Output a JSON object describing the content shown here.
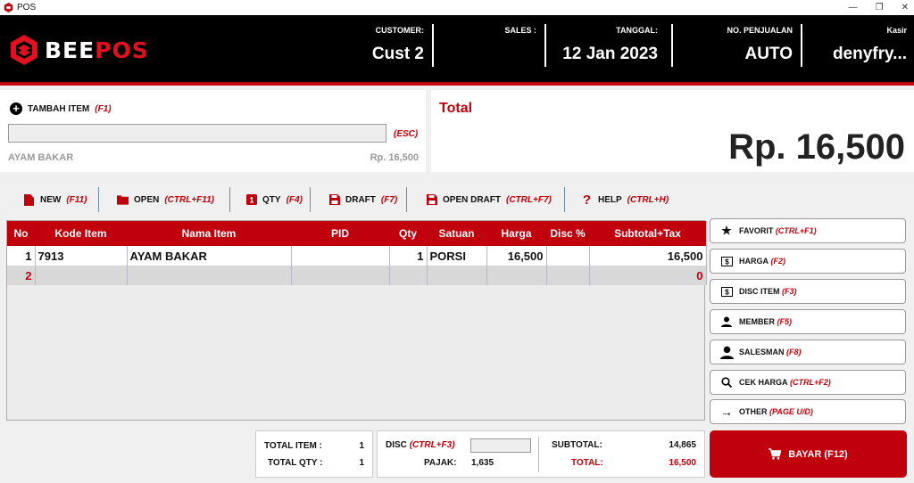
{
  "window": {
    "title": "POS",
    "controls": [
      "—",
      "❐",
      "✕"
    ]
  },
  "logo": {
    "part1": "BEE",
    "part2": "POS"
  },
  "header": {
    "customer_label": "CUSTOMER:",
    "customer_value": "Cust 2",
    "sales_label": "SALES :",
    "sales_value": "",
    "tanggal_label": "TANGGAL:",
    "tanggal_value": "12 Jan 2023",
    "no_label": "NO. PENJUALAN",
    "no_value": "AUTO",
    "kasir_label": "Kasir",
    "kasir_value": "denyfry..."
  },
  "add_item": {
    "label": "TAMBAH ITEM",
    "shortcut": "(F1)",
    "input_value": "",
    "esc": "(ESC)",
    "last_item_name": "AYAM BAKAR",
    "last_item_price": "Rp. 16,500"
  },
  "total": {
    "label": "Total",
    "value": "Rp. 16,500"
  },
  "toolbar": [
    {
      "label": "NEW",
      "shortcut": "(F11)",
      "icon": "file-icon"
    },
    {
      "label": "OPEN",
      "shortcut": "(CTRL+F11)",
      "icon": "folder-icon"
    },
    {
      "label": "QTY",
      "shortcut": "(F4)",
      "icon": "qty-icon"
    },
    {
      "label": "DRAFT",
      "shortcut": "(F7)",
      "icon": "save-icon"
    },
    {
      "label": "OPEN DRAFT",
      "shortcut": "(CTRL+F7)",
      "icon": "save-icon"
    },
    {
      "label": "HELP",
      "shortcut": "(CTRL+H)",
      "icon": "question-icon"
    }
  ],
  "table": {
    "headers": [
      "No",
      "Kode Item",
      "Nama Item",
      "PID",
      "Qty",
      "Satuan",
      "Harga",
      "Disc %",
      "Subtotal+Tax"
    ],
    "rows": [
      [
        "1",
        "7913",
        "AYAM BAKAR",
        "",
        "1",
        "PORSI",
        "16,500",
        "",
        "16,500"
      ],
      [
        "2",
        "",
        "",
        "",
        "",
        "",
        "",
        "",
        "0"
      ]
    ]
  },
  "side_buttons": [
    {
      "label": "FAVORIT",
      "shortcut": "(CTRL+F1)",
      "icon": "star-icon"
    },
    {
      "label": "HARGA",
      "shortcut": "(F2)",
      "icon": "money-icon"
    },
    {
      "label": "DISC ITEM",
      "shortcut": "(F3)",
      "icon": "money-icon"
    },
    {
      "label": "MEMBER",
      "shortcut": "(F5)",
      "icon": "person-icon"
    },
    {
      "label": "SALESMAN",
      "shortcut": "(F8)",
      "icon": "person-icon"
    },
    {
      "label": "CEK HARGA",
      "shortcut": "(CTRL+F2)",
      "icon": "search-icon"
    },
    {
      "label": "OTHER",
      "shortcut": "(PAGE U/D)",
      "icon": "arrow-right-icon"
    }
  ],
  "summary": {
    "total_item_label": "TOTAL ITEM :",
    "total_item_value": "1",
    "total_qty_label": "TOTAL QTY :",
    "total_qty_value": "1",
    "disc_label": "DISC",
    "disc_shortcut": "(CTRL+F3)",
    "disc_value": "",
    "pajak_label": "PAJAK:",
    "pajak_value": "1,635",
    "subtotal_label": "SUBTOTAL:",
    "subtotal_value": "14,865",
    "total_label": "TOTAL:",
    "total_value": "16,500"
  },
  "pay": {
    "label": "BAYAR (F12)",
    "icon": "cart-icon"
  },
  "colors": {
    "brand": "#c0000c",
    "header_bg": "#000000"
  }
}
